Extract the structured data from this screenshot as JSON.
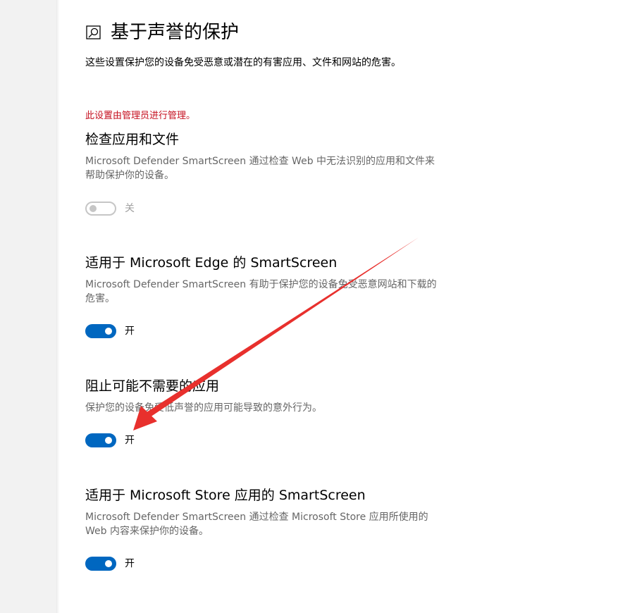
{
  "page": {
    "title": "基于声誉的保护",
    "description": "这些设置保护您的设备免受恶意或潜在的有害应用、文件和网站的危害。",
    "admin_note": "此设置由管理员进行管理。",
    "header_icon": "reputation-shield-icon"
  },
  "settings": [
    {
      "title": "检查应用和文件",
      "description": "Microsoft Defender SmartScreen 通过检查 Web 中无法识别的应用和文件来帮助保护你的设备。",
      "state": "off",
      "state_label": "关",
      "disabled": true
    },
    {
      "title": "适用于 Microsoft Edge 的 SmartScreen",
      "description": "Microsoft Defender SmartScreen 有助于保护您的设备免受恶意网站和下载的危害。",
      "state": "on",
      "state_label": "开",
      "disabled": false
    },
    {
      "title": "阻止可能不需要的应用",
      "description": "保护您的设备免受低声誉的应用可能导致的意外行为。",
      "state": "on",
      "state_label": "开",
      "disabled": false
    },
    {
      "title": "适用于 Microsoft Store 应用的 SmartScreen",
      "description": "Microsoft Defender SmartScreen 通过检查 Microsoft Store 应用所使用的 Web 内容来保护你的设备。",
      "state": "on",
      "state_label": "开",
      "disabled": false
    }
  ],
  "colors": {
    "accent": "#0067c0",
    "admin_note": "#c50f1f",
    "annotation_arrow": "#e8302d"
  }
}
